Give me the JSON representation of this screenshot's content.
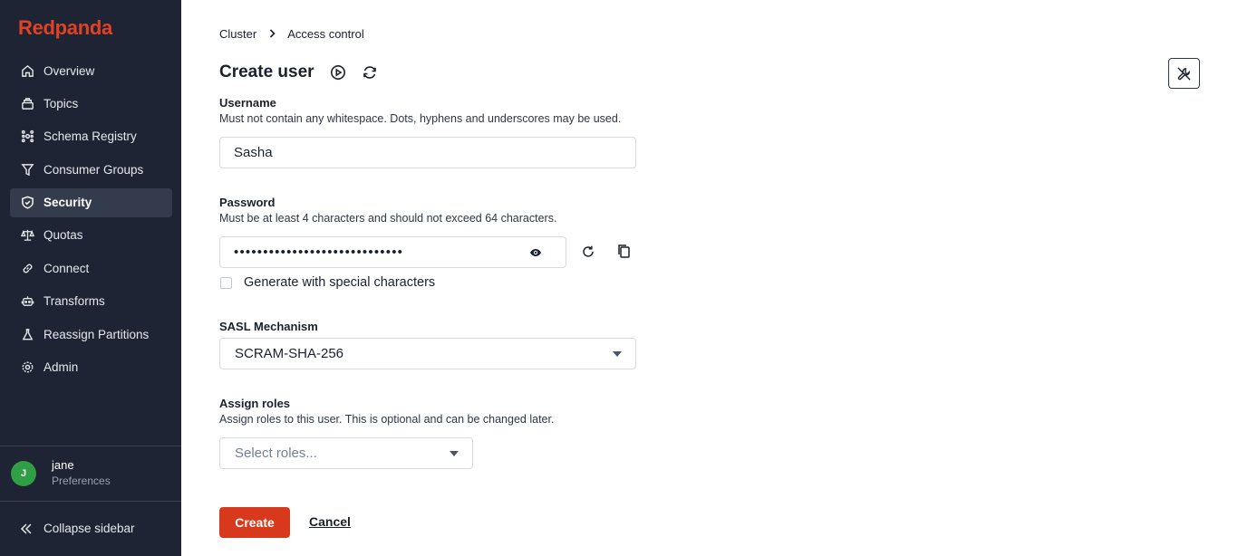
{
  "brand": {
    "name": "Redpanda",
    "color": "#e14226"
  },
  "sidebar": {
    "items": [
      {
        "label": "Overview",
        "icon": "home-icon"
      },
      {
        "label": "Topics",
        "icon": "topics-icon"
      },
      {
        "label": "Schema Registry",
        "icon": "schema-icon"
      },
      {
        "label": "Consumer Groups",
        "icon": "filter-icon"
      },
      {
        "label": "Security",
        "icon": "shield-icon",
        "active": true
      },
      {
        "label": "Quotas",
        "icon": "scale-icon"
      },
      {
        "label": "Connect",
        "icon": "link-icon"
      },
      {
        "label": "Transforms",
        "icon": "robot-icon"
      },
      {
        "label": "Reassign Partitions",
        "icon": "flask-icon"
      },
      {
        "label": "Admin",
        "icon": "gear-icon"
      }
    ],
    "user": {
      "initial": "J",
      "name": "jane",
      "sub": "Preferences"
    },
    "collapse_label": "Collapse sidebar"
  },
  "breadcrumb": {
    "root": "Cluster",
    "current": "Access control"
  },
  "page": {
    "title": "Create user"
  },
  "form": {
    "username": {
      "label": "Username",
      "help": "Must not contain any whitespace. Dots, hyphens and underscores may be used.",
      "value": "Sasha"
    },
    "password": {
      "label": "Password",
      "help": "Must be at least 4 characters and should not exceed 64 characters.",
      "masked_value": "•••••••••••••••••••••••••••••",
      "special_chars_label": "Generate with special characters",
      "special_chars_checked": false
    },
    "sasl": {
      "label": "SASL Mechanism",
      "value": "SCRAM-SHA-256"
    },
    "roles": {
      "label": "Assign roles",
      "help": "Assign roles to this user. This is optional and can be changed later.",
      "placeholder": "Select roles..."
    }
  },
  "actions": {
    "create": "Create",
    "cancel": "Cancel"
  },
  "colors": {
    "sidebar_bg": "#1e2433",
    "active_item_bg": "#343b4c",
    "primary": "#d8391c",
    "avatar": "#2f9e44"
  }
}
